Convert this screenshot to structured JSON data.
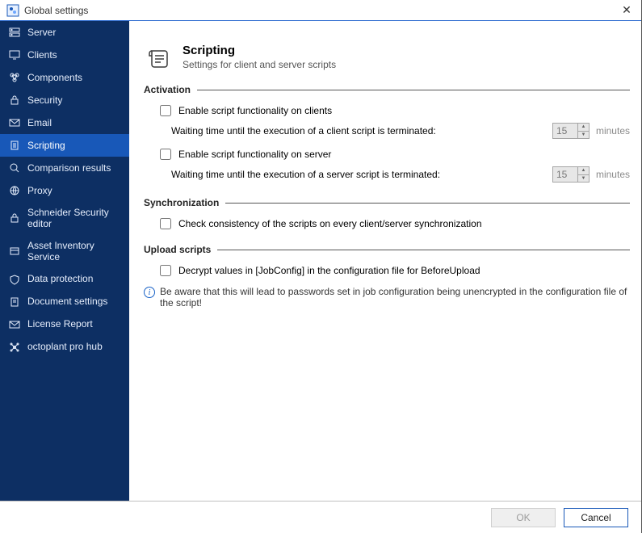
{
  "window": {
    "title": "Global settings"
  },
  "sidebar": {
    "items": [
      {
        "label": "Server"
      },
      {
        "label": "Clients"
      },
      {
        "label": "Components"
      },
      {
        "label": "Security"
      },
      {
        "label": "Email"
      },
      {
        "label": "Scripting"
      },
      {
        "label": "Comparison results"
      },
      {
        "label": "Proxy"
      },
      {
        "label": "Schneider Security editor"
      },
      {
        "label": "Asset Inventory Service"
      },
      {
        "label": "Data protection"
      },
      {
        "label": "Document settings"
      },
      {
        "label": "License Report"
      },
      {
        "label": "octoplant pro hub"
      }
    ],
    "selected_index": 5
  },
  "header": {
    "title": "Scripting",
    "subtitle": "Settings for client and server scripts"
  },
  "sections": {
    "activation": {
      "title": "Activation",
      "enable_client_label": "Enable script functionality on clients",
      "enable_client_checked": false,
      "client_wait_label": "Waiting time until the execution of a client script is terminated:",
      "client_wait_value": "15",
      "client_wait_unit": "minutes",
      "enable_server_label": "Enable script functionality on server",
      "enable_server_checked": false,
      "server_wait_label": "Waiting time until the execution of a server script is terminated:",
      "server_wait_value": "15",
      "server_wait_unit": "minutes"
    },
    "synchronization": {
      "title": "Synchronization",
      "check_label": "Check consistency of the scripts on every client/server synchronization",
      "check_checked": false
    },
    "upload": {
      "title": "Upload scripts",
      "decrypt_label": "Decrypt values in [JobConfig] in the configuration file for BeforeUpload",
      "decrypt_checked": false,
      "warning": "Be aware that this will lead to passwords set in job configuration being unencrypted in the configuration file of the script!"
    }
  },
  "footer": {
    "ok_label": "OK",
    "cancel_label": "Cancel"
  }
}
